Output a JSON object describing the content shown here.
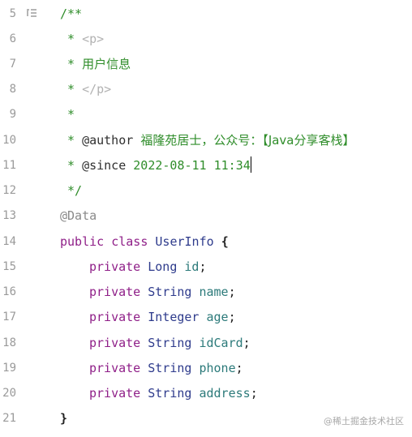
{
  "editor": {
    "lines": [
      {
        "num": "5",
        "text": "/**"
      },
      {
        "num": "6",
        "star": "* ",
        "tag": "<p>"
      },
      {
        "num": "7",
        "star": "* ",
        "text": "用户信息"
      },
      {
        "num": "8",
        "star": "* ",
        "tag": "</p>"
      },
      {
        "num": "9",
        "star": "*"
      },
      {
        "num": "10",
        "star": "* ",
        "tag_name": "@author",
        "text": "福隆苑居士，公众号：【Java分享客栈】"
      },
      {
        "num": "11",
        "star": "* ",
        "tag_name": "@since",
        "text": "2022-08-11 11:34"
      },
      {
        "num": "12",
        "text": "*/"
      },
      {
        "num": "13",
        "annotation": "@Data"
      },
      {
        "num": "14",
        "kw1": "public",
        "kw2": "class",
        "name": "UserInfo",
        "brace": "{"
      },
      {
        "num": "15",
        "mod": "private",
        "type": "Long",
        "field": "id",
        "semi": ";"
      },
      {
        "num": "16",
        "mod": "private",
        "type": "String",
        "field": "name",
        "semi": ";"
      },
      {
        "num": "17",
        "mod": "private",
        "type": "Integer",
        "field": "age",
        "semi": ";"
      },
      {
        "num": "18",
        "mod": "private",
        "type": "String",
        "field": "idCard",
        "semi": ";"
      },
      {
        "num": "19",
        "mod": "private",
        "type": "String",
        "field": "phone",
        "semi": ";"
      },
      {
        "num": "20",
        "mod": "private",
        "type": "String",
        "field": "address",
        "semi": ";"
      },
      {
        "num": "21",
        "brace": "}"
      }
    ]
  },
  "watermark": "@稀土掘金技术社区",
  "colors": {
    "comment": "#2f8d2a",
    "keyword": "#8f1f88",
    "type": "#2e3b8c",
    "field": "#2c7a7a",
    "annotation": "#8a8a8a",
    "line_number": "#9a9a9a"
  },
  "icons": [
    "fold-gutter-icon"
  ]
}
